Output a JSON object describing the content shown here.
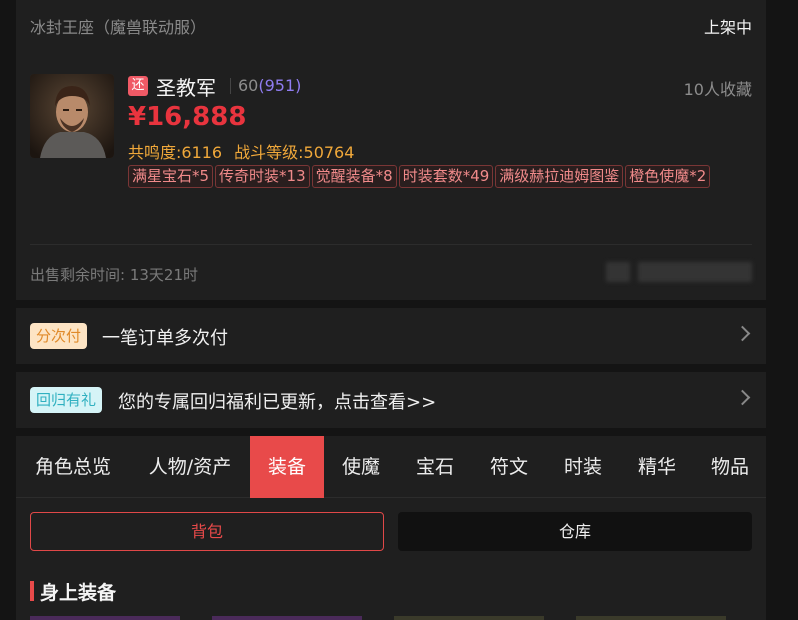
{
  "header": {
    "server": "冰封王座（魔兽联动服）",
    "status": "上架中"
  },
  "role": {
    "return_tag": "还",
    "name": "圣教军",
    "level": "60",
    "level_sub": "(951)",
    "favorites": "10人收藏",
    "price": "¥16,888",
    "resonance": "共鸣度:6116",
    "combat_level": "战斗等级:50764",
    "chips": [
      "满星宝石*5",
      "传奇时装*13",
      "觉醒装备*8",
      "时装套数*49",
      "满级赫拉迪姆图鉴",
      "橙色使魔*2"
    ],
    "remaining": "出售剩余时间: 13天21时"
  },
  "banners": {
    "installment_tag": "分次付",
    "installment_text": "一笔订单多次付",
    "return_tag": "回归有礼",
    "return_text": "您的专属回归福利已更新，点击查看>>"
  },
  "tabs": [
    "角色总览",
    "人物/资产",
    "装备",
    "使魔",
    "宝石",
    "符文",
    "时装",
    "精华",
    "物品"
  ],
  "active_tab": "装备",
  "sub_buttons": {
    "bag": "背包",
    "storage": "仓库"
  },
  "section_title": "身上装备",
  "colors": {
    "accent": "#e84a4a",
    "price": "#e8343e",
    "stats": "#f0a83a"
  }
}
